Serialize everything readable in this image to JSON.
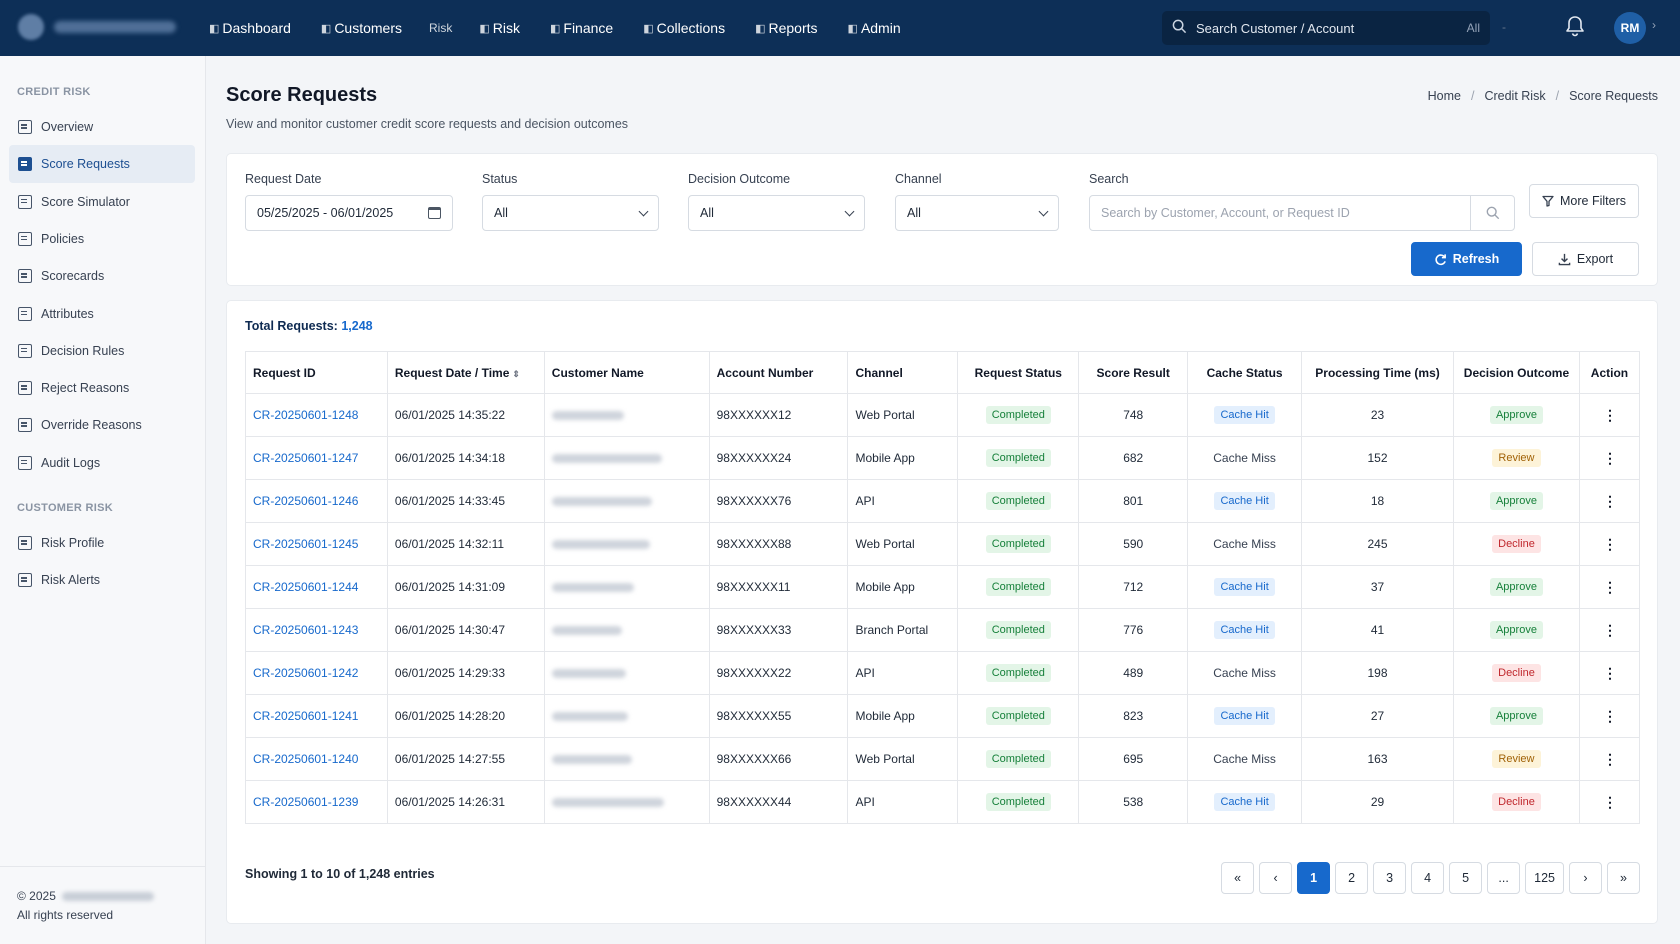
{
  "topbar": {
    "nav": [
      {
        "label": "Dashboard",
        "name": "nav-dashboard"
      },
      {
        "label": "Customers",
        "name": "nav-customers"
      },
      {
        "label": "Risk",
        "name": "nav-risk-dim",
        "dim": true
      },
      {
        "label": "Risk",
        "name": "nav-risk"
      },
      {
        "label": "Finance",
        "name": "nav-finance"
      },
      {
        "label": "Collections",
        "name": "nav-collections"
      },
      {
        "label": "Reports",
        "name": "nav-reports"
      },
      {
        "label": "Admin",
        "name": "nav-admin"
      }
    ],
    "search_text": "Search Customer / Account",
    "search_scope": "All",
    "avatar_initials": "RM",
    "icons": {
      "search": "search-icon",
      "bell": "bell-icon",
      "chevron": "chevron-right-icon"
    }
  },
  "sidebar": {
    "section1_title": "CREDIT RISK",
    "section1_items": [
      {
        "label": "Overview",
        "name": "sidebar-item-overview",
        "active": false
      },
      {
        "label": "Score Requests",
        "name": "sidebar-item-score-requests",
        "active": true
      },
      {
        "label": "Score Simulator",
        "name": "sidebar-item-score-simulator",
        "active": false
      },
      {
        "label": "Policies",
        "name": "sidebar-item-policies",
        "active": false
      },
      {
        "label": "Scorecards",
        "name": "sidebar-item-scorecards",
        "active": false
      },
      {
        "label": "Attributes",
        "name": "sidebar-item-attributes",
        "active": false
      },
      {
        "label": "Decision Rules",
        "name": "sidebar-item-decision-rules",
        "active": false
      },
      {
        "label": "Reject Reasons",
        "name": "sidebar-item-reject-reasons",
        "active": false
      },
      {
        "label": "Override Reasons",
        "name": "sidebar-item-override-reasons",
        "active": false
      },
      {
        "label": "Audit Logs",
        "name": "sidebar-item-audit-logs",
        "active": false
      }
    ],
    "section2_title": "CUSTOMER RISK",
    "section2_items": [
      {
        "label": "Risk Profile",
        "name": "sidebar-item-risk-profile",
        "active": false
      },
      {
        "label": "Risk Alerts",
        "name": "sidebar-item-risk-alerts",
        "active": false
      }
    ],
    "footer_copyright": "© 2025",
    "footer_rights": "All rights reserved"
  },
  "header": {
    "title": "Score Requests",
    "subtitle": "View and monitor customer credit score requests and decision outcomes",
    "breadcrumb": [
      "Home",
      "Credit Risk",
      "Score Requests"
    ]
  },
  "filters": {
    "request_date_label": "Request Date",
    "request_date_value": "05/25/2025 - 06/01/2025",
    "status_label": "Status",
    "status_value": "All",
    "decision_label": "Decision Outcome",
    "decision_value": "All",
    "channel_label": "Channel",
    "channel_value": "All",
    "search_label": "Search",
    "search_placeholder": "Search by Customer, Account, or Request ID",
    "more_filters": "More Filters",
    "refresh": "Refresh",
    "export": "Export"
  },
  "table": {
    "total_label": "Total Requests:",
    "total_value": "1,248",
    "columns": [
      "Request ID",
      "Request Date / Time",
      "Customer Name",
      "Account Number",
      "Channel",
      "Request Status",
      "Score Result",
      "Cache Status",
      "Processing Time (ms)",
      "Decision Outcome",
      "Action"
    ],
    "rows": [
      {
        "id": "CR-20250601-1248",
        "datetime": "06/01/2025 14:35:22",
        "account": "98XXXXXX12",
        "channel": "Web Portal",
        "status": "Completed",
        "score": "748",
        "cache": "Cache Hit",
        "ms": "23",
        "decision": "Approve"
      },
      {
        "id": "CR-20250601-1247",
        "datetime": "06/01/2025 14:34:18",
        "account": "98XXXXXX24",
        "channel": "Mobile App",
        "status": "Completed",
        "score": "682",
        "cache": "Cache Miss",
        "ms": "152",
        "decision": "Review"
      },
      {
        "id": "CR-20250601-1246",
        "datetime": "06/01/2025 14:33:45",
        "account": "98XXXXXX76",
        "channel": "API",
        "status": "Completed",
        "score": "801",
        "cache": "Cache Hit",
        "ms": "18",
        "decision": "Approve"
      },
      {
        "id": "CR-20250601-1245",
        "datetime": "06/01/2025 14:32:11",
        "account": "98XXXXXX88",
        "channel": "Web Portal",
        "status": "Completed",
        "score": "590",
        "cache": "Cache Miss",
        "ms": "245",
        "decision": "Decline"
      },
      {
        "id": "CR-20250601-1244",
        "datetime": "06/01/2025 14:31:09",
        "account": "98XXXXXX11",
        "channel": "Mobile App",
        "status": "Completed",
        "score": "712",
        "cache": "Cache Hit",
        "ms": "37",
        "decision": "Approve"
      },
      {
        "id": "CR-20250601-1243",
        "datetime": "06/01/2025 14:30:47",
        "account": "98XXXXXX33",
        "channel": "Branch Portal",
        "status": "Completed",
        "score": "776",
        "cache": "Cache Hit",
        "ms": "41",
        "decision": "Approve"
      },
      {
        "id": "CR-20250601-1242",
        "datetime": "06/01/2025 14:29:33",
        "account": "98XXXXXX22",
        "channel": "API",
        "status": "Completed",
        "score": "489",
        "cache": "Cache Miss",
        "ms": "198",
        "decision": "Decline"
      },
      {
        "id": "CR-20250601-1241",
        "datetime": "06/01/2025 14:28:20",
        "account": "98XXXXXX55",
        "channel": "Mobile App",
        "status": "Completed",
        "score": "823",
        "cache": "Cache Hit",
        "ms": "27",
        "decision": "Approve"
      },
      {
        "id": "CR-20250601-1240",
        "datetime": "06/01/2025 14:27:55",
        "account": "98XXXXXX66",
        "channel": "Web Portal",
        "status": "Completed",
        "score": "695",
        "cache": "Cache Miss",
        "ms": "163",
        "decision": "Review"
      },
      {
        "id": "CR-20250601-1239",
        "datetime": "06/01/2025 14:26:31",
        "account": "98XXXXXX44",
        "channel": "API",
        "status": "Completed",
        "score": "538",
        "cache": "Cache Hit",
        "ms": "29",
        "decision": "Decline"
      }
    ],
    "showing": "Showing 1 to 10 of 1,248 entries"
  },
  "pagination": {
    "first": "«",
    "prev": "‹",
    "pages": [
      "1",
      "2",
      "3",
      "4",
      "5",
      "...",
      "125"
    ],
    "active_page": "1",
    "next": "›",
    "last": "»"
  },
  "colors": {
    "topbar": "#0d2f57",
    "accent": "#1769cc",
    "approve": "#16803a",
    "review": "#a16207",
    "decline": "#c0272d"
  }
}
